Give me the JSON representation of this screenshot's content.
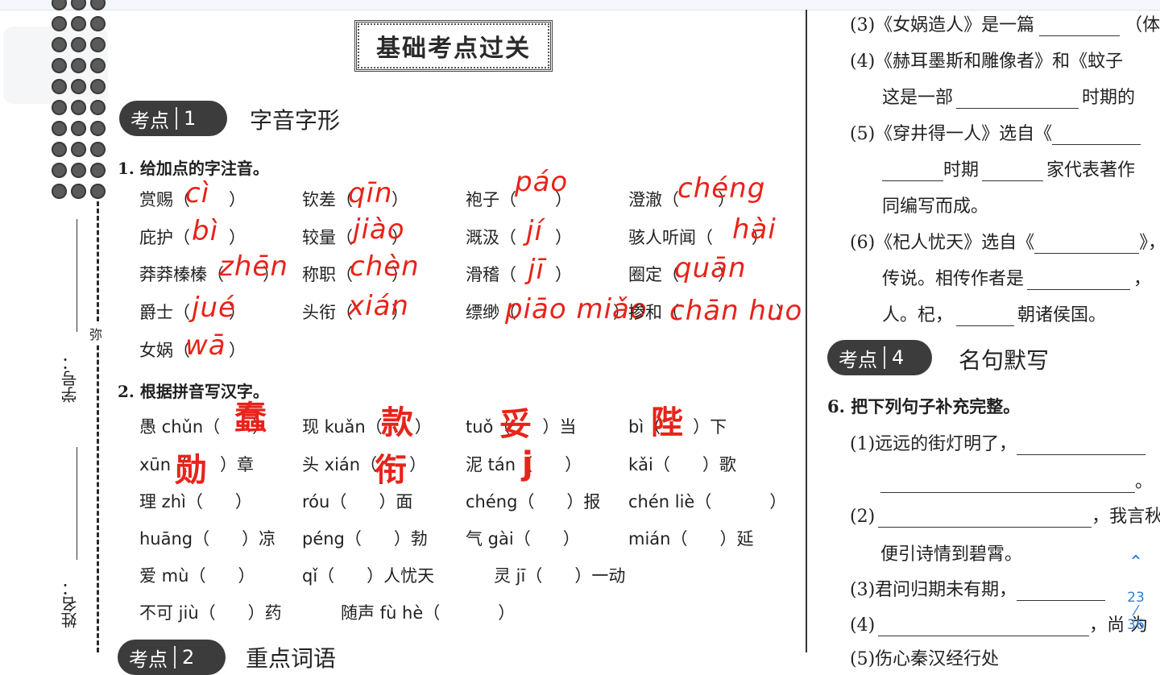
{
  "viewer": {
    "page_current": "23",
    "page_total": "36",
    "scroll_up_icon": "chevron-up-icon",
    "accent_color": "#2f7fd6"
  },
  "binding": {
    "student_id_label": "学号：",
    "name_label": "姓名：",
    "side_char": "弥"
  },
  "left_page": {
    "section_title": "基础考点过关",
    "kaodian1": {
      "badge": "考点",
      "num": "1",
      "title": "字音字形"
    },
    "q1": {
      "label": "1. 给加点的字注音。",
      "items": [
        {
          "word": "赏赐（",
          "close": "）",
          "answer": "cì"
        },
        {
          "word": "钦差（",
          "close": "）",
          "answer": "qīn"
        },
        {
          "word": "袍子（",
          "close": "）",
          "answer": "páo"
        },
        {
          "word": "澄澈（",
          "close": "）",
          "answer": "chéng"
        },
        {
          "word": "庇护（",
          "close": "）",
          "answer": "bì"
        },
        {
          "word": "较量（",
          "close": "）",
          "answer": "jiào"
        },
        {
          "word": "溉汲（",
          "close": "）",
          "answer": "jí"
        },
        {
          "word": "骇人听闻（",
          "close": "）",
          "answer": "hài"
        },
        {
          "word": "莽莽榛榛（",
          "close": "）",
          "answer": "zhēn"
        },
        {
          "word": "称职（",
          "close": "）",
          "answer": "chèn"
        },
        {
          "word": "滑稽（",
          "close": "）",
          "answer": "jī"
        },
        {
          "word": "圈定（",
          "close": "）",
          "answer": "quān"
        },
        {
          "word": "爵士（",
          "close": "）",
          "answer": "jué"
        },
        {
          "word": "头衔（",
          "close": "）",
          "answer": "xián"
        },
        {
          "word": "缥缈（",
          "close": "）",
          "answer": "piāo miǎo"
        },
        {
          "word": "掺和（",
          "close": "）",
          "answer": "chān huo"
        },
        {
          "word": "女娲（",
          "close": "）",
          "answer": "wā"
        }
      ]
    },
    "q2": {
      "label": "2. 根据拼音写汉字。",
      "items": [
        {
          "pre": "愚 chǔn（",
          "post": "）",
          "answer": "蠢"
        },
        {
          "pre": "现 kuǎn（",
          "post": "）",
          "answer": "款"
        },
        {
          "pre": "tuǒ（",
          "post": "）当",
          "answer": "妥"
        },
        {
          "pre": "bì（",
          "post": "）下",
          "answer": "陛"
        },
        {
          "pre": "xūn（",
          "post": "）章",
          "answer": "勋"
        },
        {
          "pre": "头 xián（",
          "post": "）",
          "answer": "衔"
        },
        {
          "pre": "泥 tán（",
          "post": "）",
          "answer": "j"
        },
        {
          "pre": "kǎi（",
          "post": "）歌",
          "answer": ""
        },
        {
          "pre": "理 zhì（",
          "post": "）",
          "answer": ""
        },
        {
          "pre": "róu（",
          "post": "）面",
          "answer": ""
        },
        {
          "pre": "chéng（",
          "post": "）报",
          "answer": ""
        },
        {
          "pre": "chén liè（",
          "post": "）",
          "answer": ""
        },
        {
          "pre": "huāng（",
          "post": "）凉",
          "answer": ""
        },
        {
          "pre": "péng（",
          "post": "）勃",
          "answer": ""
        },
        {
          "pre": "气 gài（",
          "post": "）",
          "answer": ""
        },
        {
          "pre": "mián（",
          "post": "）延",
          "answer": ""
        },
        {
          "pre": "爱 mù（",
          "post": "）",
          "answer": ""
        },
        {
          "pre": "qǐ（",
          "post": "）人忧天",
          "answer": ""
        },
        {
          "pre": "灵 jī（",
          "post": "）一动",
          "answer": ""
        },
        {
          "pre": "不可 jiù（",
          "post": "）药",
          "answer": ""
        },
        {
          "pre": "随声 fù hè（",
          "post": "）",
          "answer": ""
        }
      ]
    },
    "kaodian2": {
      "badge": "考点",
      "num": "2",
      "title": "重点词语"
    }
  },
  "right_page": {
    "lines": [
      {
        "text_before": "(3)《女娲造人》是一篇",
        "text_after": "（体"
      },
      {
        "text_before": "(4)《赫耳墨斯和雕像者》和《蚊子",
        "text_after": ""
      },
      {
        "text_before": "这是一部",
        "text_after": "时期的"
      },
      {
        "text_before": "(5)《穿井得一人》选自《",
        "text_after": ""
      },
      {
        "text_before": "",
        "text_mid": "时期",
        "text_after": "家代表著作"
      },
      {
        "text_before": "同编写而成。",
        "text_after": ""
      },
      {
        "text_before": "(6)《杞人忧天》选自《",
        "text_after": "》，"
      },
      {
        "text_before": "传说。相传作者是",
        "text_after": "，"
      },
      {
        "text_before": "人。杞，",
        "text_after": "朝诸侯国。"
      }
    ],
    "kaodian4": {
      "badge": "考点",
      "num": "4",
      "title": "名句默写"
    },
    "q6": {
      "label": "6. 把下列句子补充完整。",
      "items": [
        {
          "before": "(1)远远的街灯明了，",
          "after": ""
        },
        {
          "before": "",
          "after": "。"
        },
        {
          "before": "(2)",
          "after": "，我言秋"
        },
        {
          "before": "便引诗情到碧霄。",
          "after": ""
        },
        {
          "before": "(3)君问归期未有期，",
          "after": ""
        },
        {
          "before": "(4)",
          "after": "，尚 为"
        },
        {
          "before": "(5)伤心秦汉经行处",
          "after": ""
        }
      ]
    }
  }
}
